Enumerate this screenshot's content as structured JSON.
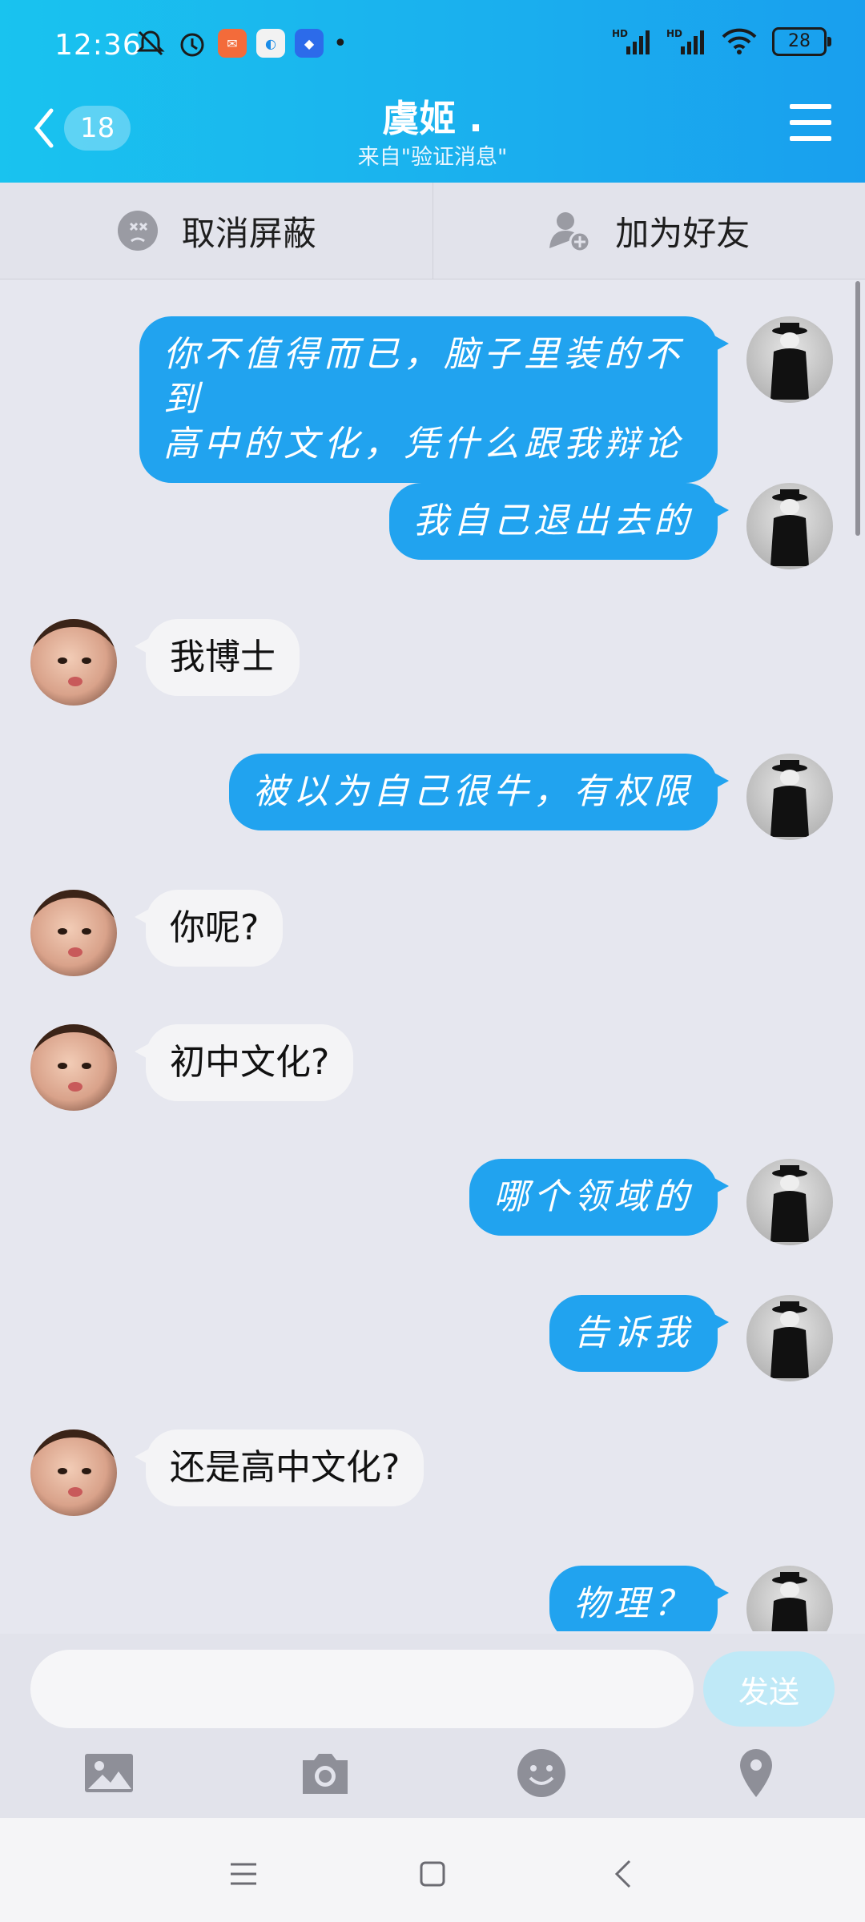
{
  "status_bar": {
    "time": "12:36",
    "battery": "28",
    "signal_labels": [
      "HD",
      "HD"
    ]
  },
  "header": {
    "back_count": "18",
    "title": "虞姬 .",
    "subtitle": "来自\"验证消息\""
  },
  "actions": {
    "unblock_label": "取消屏蔽",
    "add_friend_label": "加为好友"
  },
  "messages": [
    {
      "side": "self",
      "line1": "你不值得而已，脑子里装的不到",
      "line2": "高中的文化，凭什么跟我辩论"
    },
    {
      "side": "self",
      "text": "我自己退出去的"
    },
    {
      "side": "peer",
      "text": "我博士"
    },
    {
      "side": "self",
      "text": "被以为自己很牛，有权限"
    },
    {
      "side": "peer",
      "text": "你呢?"
    },
    {
      "side": "peer",
      "text": "初中文化?"
    },
    {
      "side": "self",
      "text": "哪个领域的"
    },
    {
      "side": "self",
      "text": "告诉我"
    },
    {
      "side": "peer",
      "text": "还是高中文化?"
    },
    {
      "side": "self",
      "text": "物理？"
    }
  ],
  "input": {
    "value": "",
    "send_label": "发送"
  },
  "toolbar": [
    "image-icon",
    "camera-icon",
    "emoji-icon",
    "location-icon"
  ],
  "colors": {
    "header_start": "#19c3ef",
    "header_end": "#199fee",
    "self_bubble": "#21a3ef",
    "peer_bubble": "#f4f4f6",
    "send_disabled": "#bfe9f7"
  }
}
